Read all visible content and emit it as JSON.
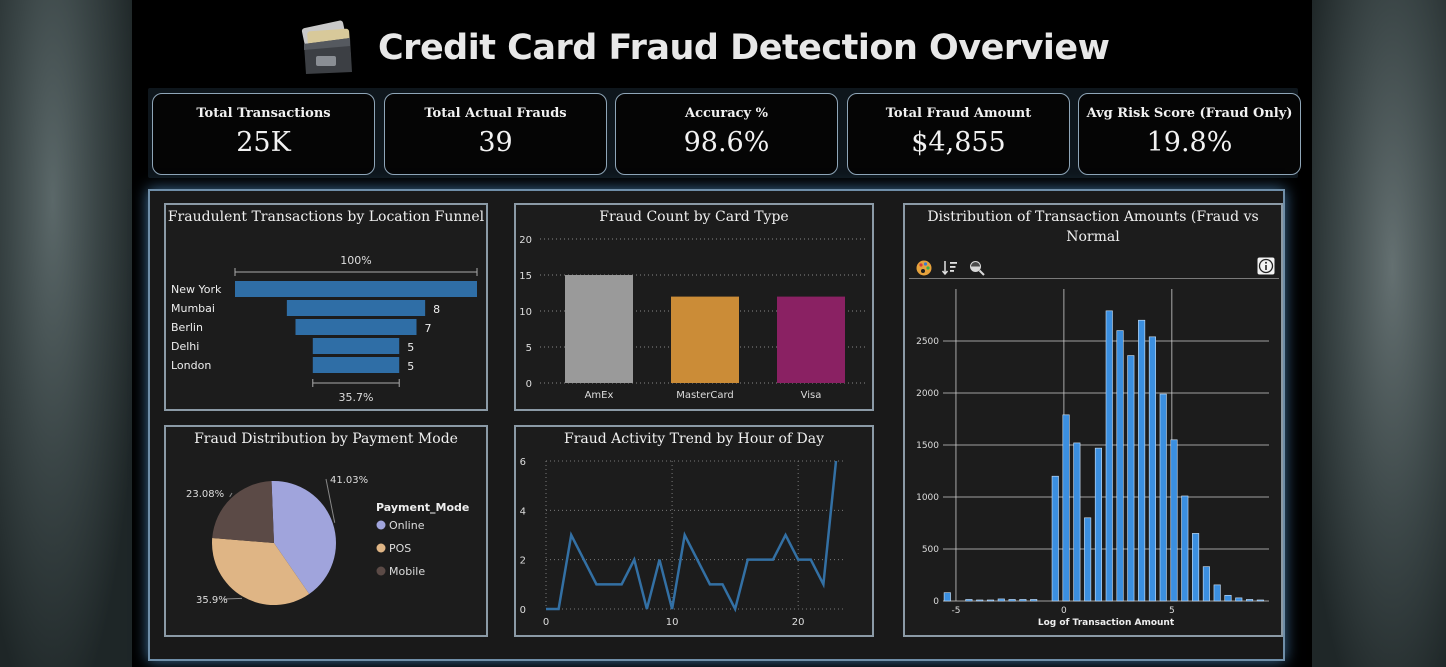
{
  "header": {
    "title": "Credit Card Fraud Detection Overview"
  },
  "kpis": [
    {
      "label": "Total Transactions",
      "value": "25K"
    },
    {
      "label": "Total Actual Frauds",
      "value": "39"
    },
    {
      "label": "Accuracy %",
      "value": "98.6%"
    },
    {
      "label": "Total Fraud Amount",
      "value": "$4,855"
    },
    {
      "label": "Avg Risk Score (Fraud Only)",
      "value": "19.8%"
    }
  ],
  "colors": {
    "funnel": "#2f6ea6",
    "amex": "#9a9a9a",
    "mastercard": "#cb8c37",
    "visa": "#8a2163",
    "online": "#a0a4dc",
    "pos": "#dfb585",
    "mobile": "#5b4a46",
    "line": "#3370a4",
    "hist": "#3b8fe0"
  },
  "chart_data": [
    {
      "type": "bar",
      "subtype": "funnel",
      "title": "Fraudulent Transactions by Location Funnel",
      "categories": [
        "New York",
        "Mumbai",
        "Berlin",
        "Delhi",
        "London"
      ],
      "values": [
        14,
        8,
        7,
        5,
        5
      ],
      "value_labels": [
        "",
        "8",
        "7",
        "5",
        "5"
      ],
      "top_label": "100%",
      "bottom_label": "35.7%"
    },
    {
      "type": "bar",
      "title": "Fraud Count by Card Type",
      "categories": [
        "AmEx",
        "MasterCard",
        "Visa"
      ],
      "values": [
        15,
        12,
        12
      ],
      "ylim": [
        0,
        20
      ],
      "yticks": [
        0,
        5,
        10,
        15,
        20
      ],
      "grid": true
    },
    {
      "type": "pie",
      "title": "Fraud Distribution by Payment Mode",
      "legend_title": "Payment_Mode",
      "labels": [
        "Online",
        "POS",
        "Mobile"
      ],
      "values": [
        41.03,
        35.9,
        23.08
      ],
      "value_labels": [
        "41.03%",
        "35.9%",
        "23.08%"
      ],
      "legend_position": "right"
    },
    {
      "type": "line",
      "title": "Fraud Activity Trend by Hour of Day",
      "x": [
        0,
        1,
        2,
        3,
        4,
        5,
        6,
        7,
        8,
        9,
        10,
        11,
        12,
        13,
        14,
        15,
        16,
        17,
        18,
        19,
        20,
        21,
        22,
        23
      ],
      "values": [
        0,
        0,
        3,
        2,
        1,
        1,
        1,
        2,
        0,
        2,
        0,
        3,
        2,
        1,
        1,
        0,
        2,
        2,
        2,
        3,
        2,
        2,
        1,
        6
      ],
      "xticks": [
        0,
        10,
        20
      ],
      "yticks": [
        0,
        2,
        4,
        6
      ],
      "ylim": [
        0,
        6
      ],
      "grid": true
    },
    {
      "type": "bar",
      "subtype": "histogram",
      "title": "Distribution of Transaction Amounts (Fraud vs Normal",
      "xlabel": "Log of Transaction Amount",
      "x": [
        -5.4,
        -4.9,
        -4.4,
        -3.9,
        -3.4,
        -2.9,
        -2.4,
        -1.9,
        -1.4,
        -0.9,
        -0.4,
        0.1,
        0.6,
        1.1,
        1.6,
        2.1,
        2.6,
        3.1,
        3.6,
        4.1,
        4.6,
        5.1,
        5.6,
        6.1,
        6.6,
        7.1,
        7.6,
        8.1,
        8.6,
        9.1
      ],
      "values": [
        80,
        0,
        15,
        10,
        10,
        20,
        15,
        15,
        15,
        0,
        1200,
        1790,
        1520,
        800,
        1470,
        2790,
        2600,
        2360,
        2700,
        2540,
        1990,
        1550,
        1010,
        650,
        330,
        155,
        55,
        30,
        15,
        10
      ],
      "xlim": [
        -5.6,
        9.5
      ],
      "ylim": [
        0,
        3000
      ],
      "xticks": [
        -5,
        0,
        5
      ],
      "yticks": [
        0,
        500,
        1000,
        1500,
        2000,
        2500
      ],
      "grid": true
    }
  ]
}
